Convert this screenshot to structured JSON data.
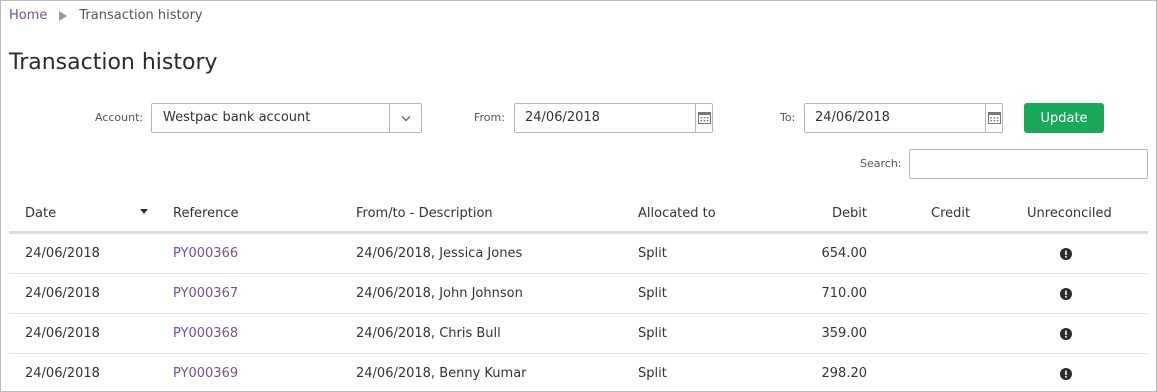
{
  "breadcrumb": {
    "home": "Home",
    "current": "Transaction history"
  },
  "page_title": "Transaction history",
  "filters": {
    "account_label": "Account:",
    "account_value": "Westpac bank account",
    "from_label": "From:",
    "from_value": "24/06/2018",
    "to_label": "To:",
    "to_value": "24/06/2018",
    "update_label": "Update",
    "search_label": "Search:",
    "search_value": ""
  },
  "table": {
    "headers": {
      "date": "Date",
      "reference": "Reference",
      "description": "From/to - Description",
      "allocated": "Allocated to",
      "debit": "Debit",
      "credit": "Credit",
      "unreconciled": "Unreconciled"
    },
    "rows": [
      {
        "date": "24/06/2018",
        "reference": "PY000366",
        "description": "24/06/2018, Jessica Jones",
        "allocated": "Split",
        "debit": "654.00",
        "credit": ""
      },
      {
        "date": "24/06/2018",
        "reference": "PY000367",
        "description": "24/06/2018, John Johnson",
        "allocated": "Split",
        "debit": "710.00",
        "credit": ""
      },
      {
        "date": "24/06/2018",
        "reference": "PY000368",
        "description": "24/06/2018, Chris Bull",
        "allocated": "Split",
        "debit": "359.00",
        "credit": ""
      },
      {
        "date": "24/06/2018",
        "reference": "PY000369",
        "description": "24/06/2018, Benny Kumar",
        "allocated": "Split",
        "debit": "298.20",
        "credit": ""
      }
    ]
  },
  "icons": {
    "breadcrumb_separator": "triangle-right-icon",
    "dropdown": "chevron-down-icon",
    "calendar": "calendar-icon",
    "sort": "sort-desc-icon",
    "unreconciled": "exclamation-circle-icon"
  },
  "colors": {
    "link": "#7a4e9c",
    "primary_button": "#1aa85b"
  }
}
